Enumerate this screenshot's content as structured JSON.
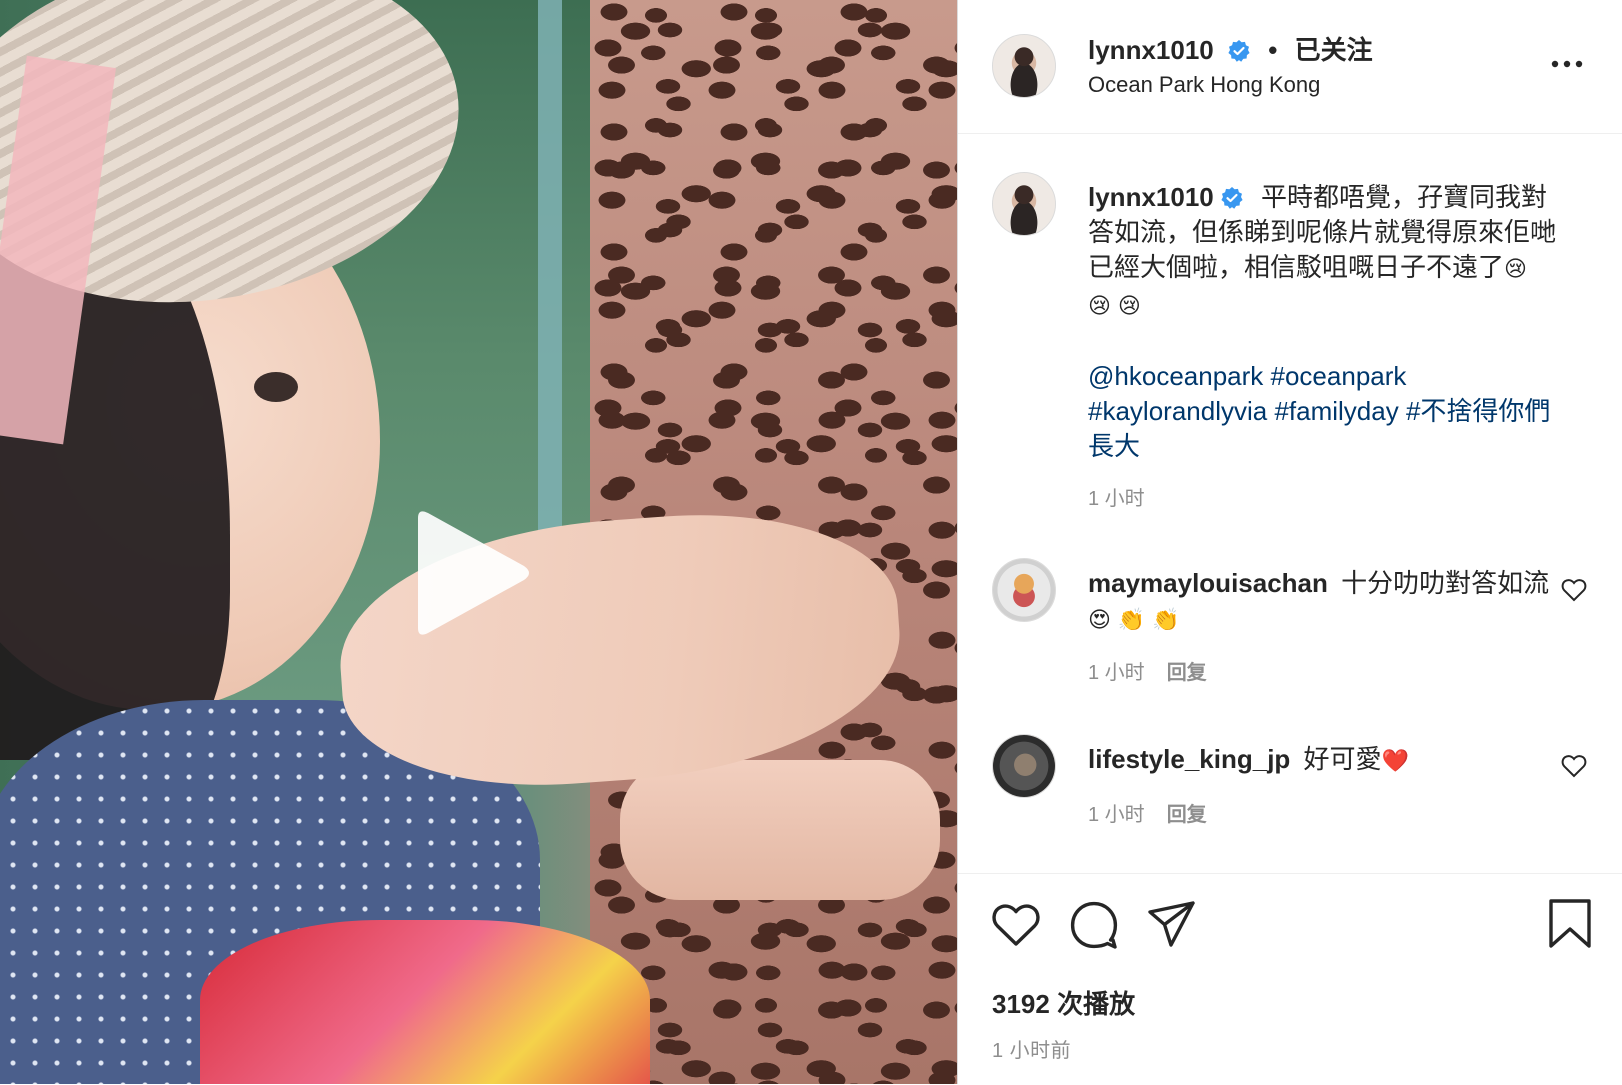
{
  "header": {
    "username": "lynnx1010",
    "separator": "•",
    "follow_label": "已关注",
    "location": "Ocean Park Hong Kong"
  },
  "caption": {
    "username": "lynnx1010",
    "text_line1": "平時都唔覺，孖寶同我對答如流，但係睇到呢條片就覺得原來佢哋已經大個啦，相信駁咀嘅日子不遠了",
    "emojis_line1": "😢",
    "emojis_line2": "😢 😢",
    "mention": "@hkoceanpark",
    "hashtags": [
      "#oceanpark",
      "#kaylorandlyvia",
      "#familyday",
      "#不捨得你們長大"
    ],
    "time": "1 小时"
  },
  "comments": [
    {
      "username": "maymaylouisachan",
      "text": "十分叻叻對答如流",
      "emojis": "😍 👏 👏",
      "time": "1 小时",
      "reply_label": "回复",
      "avatar": "avatar-maymay"
    },
    {
      "username": "lifestyle_king_jp",
      "text": "好可愛",
      "emojis": "❤️",
      "time": "1 小时",
      "reply_label": "回复",
      "avatar": "avatar-lifestyle"
    }
  ],
  "actions": {
    "icons": [
      "heart-icon",
      "comment-icon",
      "share-icon",
      "bookmark-icon"
    ],
    "plays": "3192 次播放",
    "time": "1 小时前"
  },
  "colors": {
    "verified": "#3897f0",
    "link": "#00376b",
    "muted": "#8e8e8e",
    "text": "#262626"
  }
}
